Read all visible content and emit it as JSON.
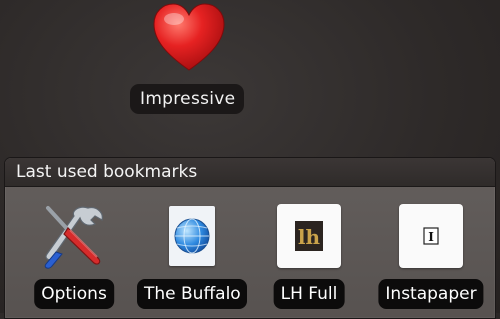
{
  "home": {
    "shortcut": {
      "label": "Impressive",
      "icon": "heart-icon"
    }
  },
  "bookmarks_widget": {
    "title": "Last used bookmarks",
    "items": [
      {
        "label": "Options",
        "icon": "tools-icon"
      },
      {
        "label": "The Buffalo",
        "icon": "globe-icon"
      },
      {
        "label": "LH Full",
        "icon": "lh-logo-icon"
      },
      {
        "label": "Instapaper",
        "icon": "instapaper-icon"
      }
    ]
  },
  "colors": {
    "heart": "#e0191a",
    "widget_body": "#5e5957",
    "label_bg": "#0c0b0b"
  }
}
